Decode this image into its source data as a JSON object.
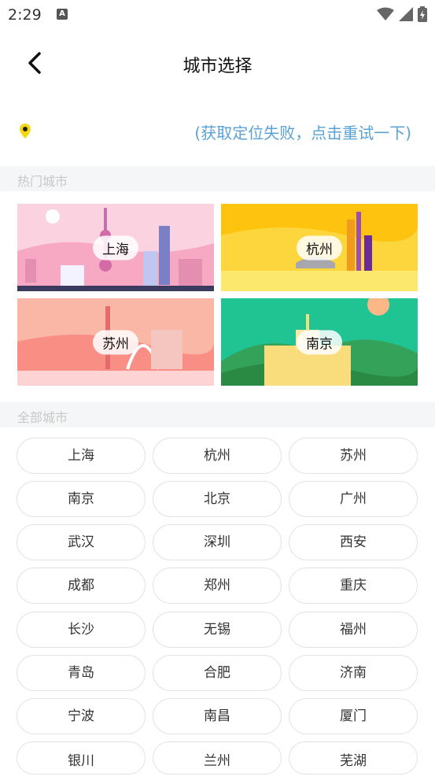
{
  "status_bar": {
    "time": "2:29",
    "notification_icon_letter": "A"
  },
  "nav": {
    "title": "城市选择"
  },
  "location": {
    "retry_text": "(获取定位失败，点击重试一下)"
  },
  "sections": {
    "hot": "热门城市",
    "all": "全部城市"
  },
  "hot_cities": [
    {
      "name": "上海",
      "theme": "pink-skyline"
    },
    {
      "name": "杭州",
      "theme": "yellow-skyline"
    },
    {
      "name": "苏州",
      "theme": "peach-skyline"
    },
    {
      "name": "南京",
      "theme": "green-hills"
    }
  ],
  "all_cities": [
    "上海",
    "杭州",
    "苏州",
    "南京",
    "北京",
    "广州",
    "武汉",
    "深圳",
    "西安",
    "成都",
    "郑州",
    "重庆",
    "长沙",
    "无锡",
    "福州",
    "青岛",
    "合肥",
    "济南",
    "宁波",
    "南昌",
    "厦门",
    "银川",
    "兰州",
    "芜湖"
  ],
  "colors": {
    "accent": "#5aa2d4",
    "pin": "#f6d60f",
    "section_bg": "#f5f6f7"
  }
}
